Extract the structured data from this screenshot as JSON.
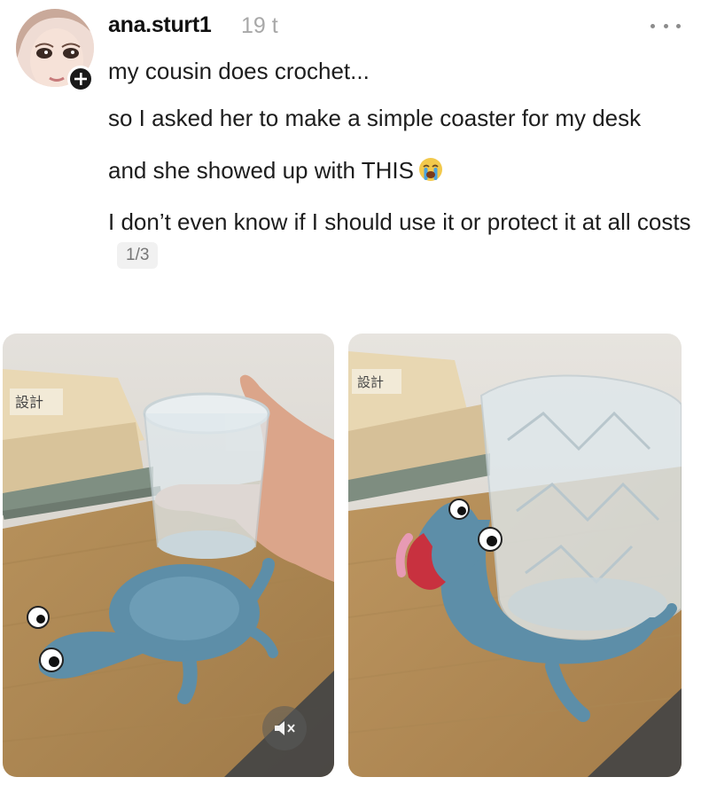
{
  "post": {
    "author": {
      "username": "ana.sturt1",
      "timestamp": "19 t"
    },
    "paragraphs": [
      "my cousin does crochet...",
      "so I asked her to make a simple coaster for my desk",
      "and she showed up with THIS",
      "I don’t even know if I should use it or protect it at all costs"
    ],
    "emoji": "crying-face-emoji",
    "page_indicator": "1/3",
    "images": [
      {
        "name": "coaster-photo-1",
        "book_spine_text": "設計"
      },
      {
        "name": "coaster-photo-2",
        "book_spine_text": "設計"
      }
    ],
    "controls": {
      "follow_icon": "plus-icon",
      "more_icon": "more-icon",
      "mute_icon": "speaker-muted-icon"
    }
  },
  "colors": {
    "crochet_blue": "#5d8ea8",
    "desk_wood": "#c29a63",
    "mouth_red": "#c8313f"
  }
}
